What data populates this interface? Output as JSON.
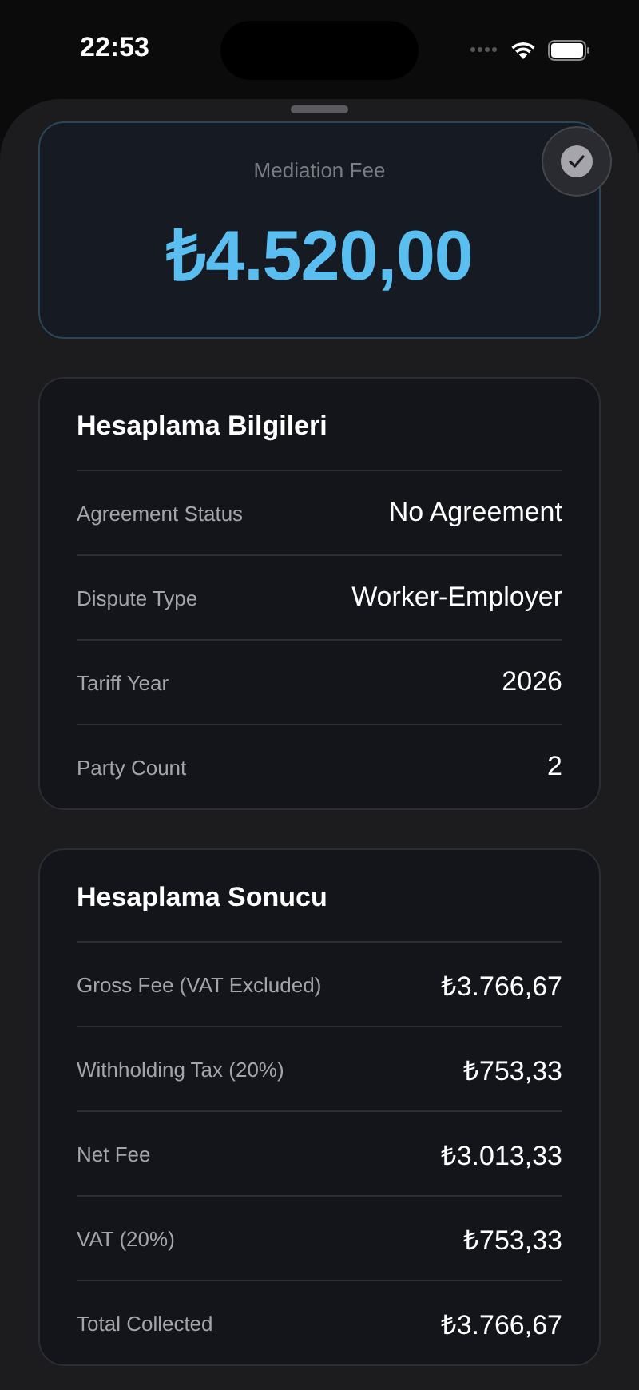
{
  "status_bar": {
    "time": "22:53"
  },
  "fee": {
    "label": "Mediation Fee",
    "amount": "₺4.520,00"
  },
  "sections": [
    {
      "title": "Hesaplama Bilgileri",
      "rows": [
        {
          "label": "Agreement Status",
          "value": "No Agreement"
        },
        {
          "label": "Dispute Type",
          "value": "Worker-Employer"
        },
        {
          "label": "Tariff Year",
          "value": "2026"
        },
        {
          "label": "Party Count",
          "value": "2"
        }
      ]
    },
    {
      "title": "Hesaplama Sonucu",
      "rows": [
        {
          "label": "Gross Fee (VAT Excluded)",
          "value": "₺3.766,67"
        },
        {
          "label": "Withholding Tax (20%)",
          "value": "₺753,33"
        },
        {
          "label": "Net Fee",
          "value": "₺3.013,33"
        },
        {
          "label": "VAT (20%)",
          "value": "₺753,33"
        },
        {
          "label": "Total Collected",
          "value": "₺3.766,67"
        }
      ]
    }
  ]
}
